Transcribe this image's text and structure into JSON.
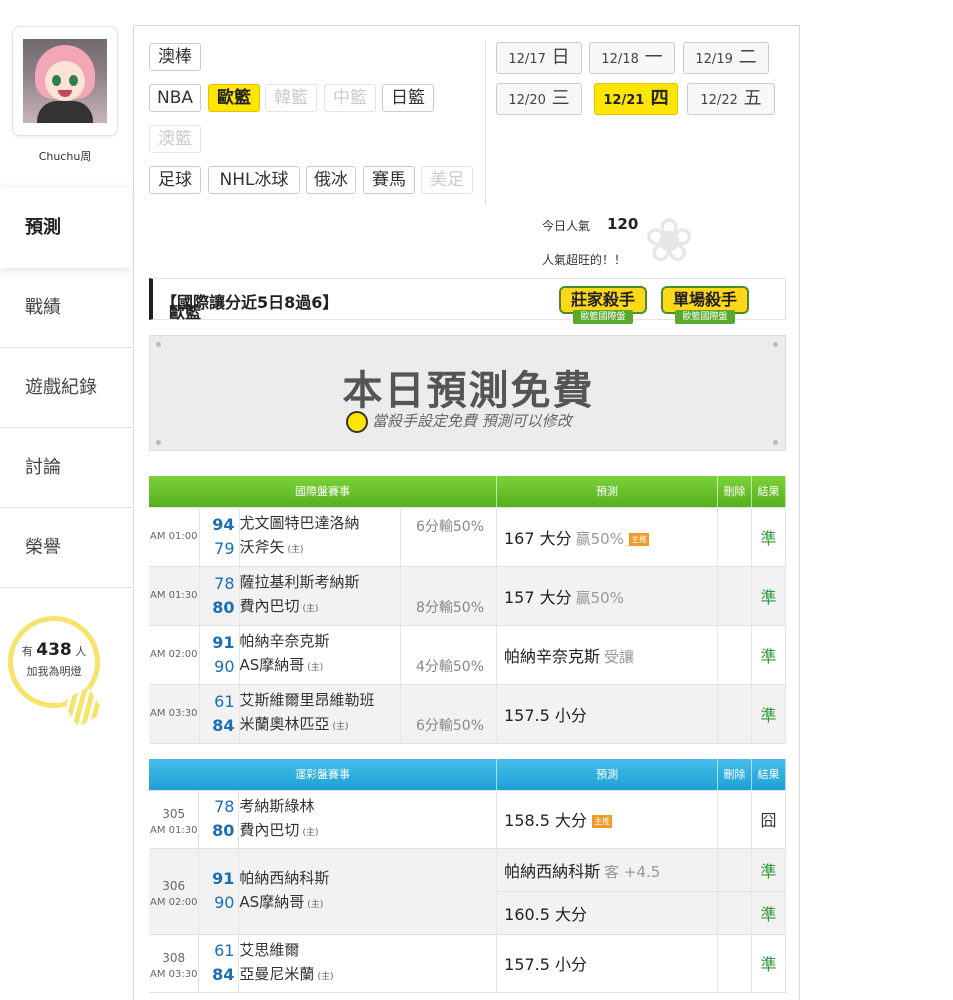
{
  "user": {
    "name": "Chuchu周"
  },
  "nav": {
    "items": [
      "預測",
      "戰績",
      "遊戲紀錄",
      "討論",
      "榮譽"
    ]
  },
  "fans": {
    "prefix": "有",
    "count": "438",
    "suffix": "人",
    "text": "加我為明燈"
  },
  "sports": {
    "row1": [
      "澳棒"
    ],
    "row2": [
      "NBA",
      "歐籃",
      "韓籃",
      "中籃",
      "日籃"
    ],
    "row3": [
      "澳籃"
    ],
    "row4": [
      "足球",
      "NHL冰球",
      "俄冰",
      "賽馬",
      "美足"
    ]
  },
  "dates": [
    {
      "md": "12/17",
      "day": "日"
    },
    {
      "md": "12/18",
      "day": "一"
    },
    {
      "md": "12/19",
      "day": "二"
    },
    {
      "md": "12/20",
      "day": "三"
    },
    {
      "md": "12/21",
      "day": "四"
    },
    {
      "md": "12/22",
      "day": "五"
    }
  ],
  "popularity": {
    "label": "今日人氣",
    "count": "120",
    "comment": "人氣超旺的！！"
  },
  "title": {
    "league": "歐籃",
    "record": "【國際讓分近5日8過6】"
  },
  "badges": [
    {
      "title": "莊家殺手",
      "sub": "歐籃國際盤"
    },
    {
      "title": "單場殺手",
      "sub": "歐籃國際盤"
    }
  ],
  "free": {
    "title": "本日預測免費",
    "subtitle": "當殺手設定免費  預測可以修改"
  },
  "intl": {
    "headers": [
      "國際盤賽事",
      "預測",
      "刪除",
      "結果"
    ],
    "rows": [
      {
        "time": "AM 01:00",
        "s1": "94",
        "s2": "79",
        "t1": "尤文圖特巴達洛納",
        "t2": "沃斧矢",
        "home": "(主)",
        "odds": "6分輸50%",
        "pred": "167 大分",
        "pred_sub": "贏50%",
        "main": "主推",
        "res": "準"
      },
      {
        "time": "AM 01:30",
        "s1": "78",
        "s2": "80",
        "t1": "薩拉基利斯考納斯",
        "t2": "費內巴切",
        "home": "(主)",
        "odds": "8分輸50%",
        "pred": "157 大分",
        "pred_sub": "贏50%",
        "main": "",
        "res": "準"
      },
      {
        "time": "AM 02:00",
        "s1": "91",
        "s2": "90",
        "t1": "帕納辛奈克斯",
        "t2": "AS摩納哥",
        "home": "(主)",
        "odds": "4分輸50%",
        "pred": "帕納辛奈克斯",
        "pred_sub": "受讓",
        "main": "",
        "res": "準"
      },
      {
        "time": "AM 03:30",
        "s1": "61",
        "s2": "84",
        "t1": "艾斯維爾里昂維勒班",
        "t2": "米蘭奧林匹亞",
        "home": "(主)",
        "odds": "6分輸50%",
        "pred": "157.5 小分",
        "pred_sub": "",
        "main": "",
        "res": "準"
      }
    ]
  },
  "lottery": {
    "headers": [
      "運彩盤賽事",
      "預測",
      "刪除",
      "結果"
    ],
    "rows": [
      {
        "no": "305",
        "time": "AM 01:30",
        "s1": "78",
        "s2": "80",
        "t1": "考納斯綠林",
        "t2": "費內巴切",
        "home": "(主)",
        "pred": "158.5 大分",
        "main": "主推",
        "res": "囧"
      },
      {
        "no": "306",
        "time": "AM 02:00",
        "s1": "91",
        "s2": "90",
        "t1": "帕納西納科斯",
        "t2": "AS摩納哥",
        "home": "(主)",
        "pred": "帕納西納科斯",
        "pred_sub": "客 +4.5",
        "res": "準",
        "pred2": "160.5 大分",
        "res2": "準"
      },
      {
        "no": "308",
        "time": "AM 03:30",
        "s1": "61",
        "s2": "84",
        "t1": "艾思維爾",
        "t2": "亞曼尼米蘭",
        "home": "(主)",
        "pred": "157.5 小分",
        "res": "準"
      }
    ]
  }
}
